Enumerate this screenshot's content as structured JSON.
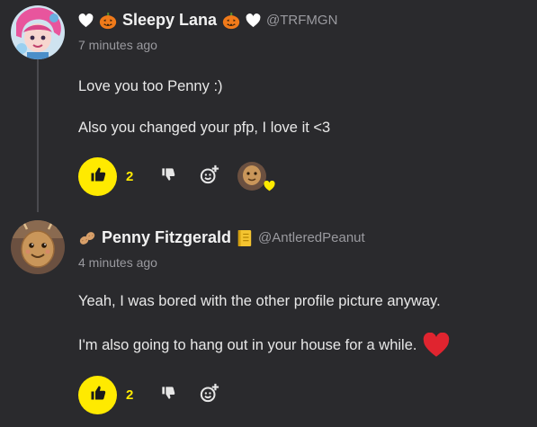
{
  "comments": [
    {
      "author": "Sleepy Lana",
      "handle": "@TRFMGN",
      "timestamp": "7 minutes ago",
      "lines": [
        "Love you too Penny :)",
        "Also you changed your pfp, I love it <3"
      ],
      "likes": "2",
      "colors": {
        "avatar_bg": "#cfe3f0",
        "hair": "#e8559d"
      }
    },
    {
      "author": "Penny Fitzgerald",
      "handle": "@AntleredPeanut",
      "timestamp": "4 minutes ago",
      "lines": [
        "Yeah, I was bored with the other profile picture anyway.",
        "I'm also going to hang out in your house for a while."
      ],
      "likes": "2",
      "colors": {
        "avatar_bg": "#6b5040",
        "peanut": "#c9965a"
      }
    }
  ],
  "accent": "#ffea00",
  "background": "#2a2a2d",
  "icons": [
    "heart-icon",
    "pumpkin-icon",
    "thumbs-up-icon",
    "thumbs-down-icon",
    "add-reaction-icon",
    "peanut-icon",
    "notebook-icon"
  ]
}
